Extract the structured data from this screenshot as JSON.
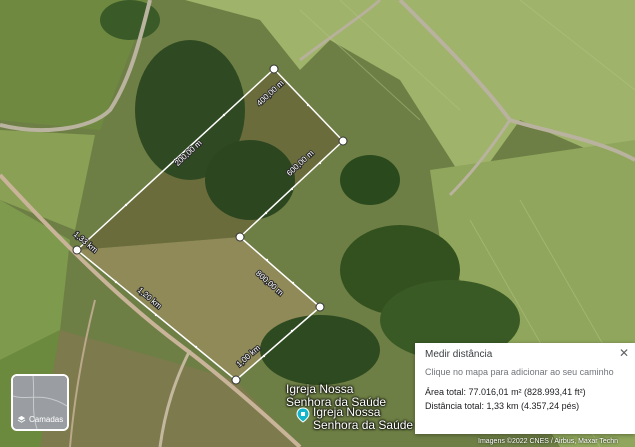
{
  "map": {
    "segment_labels": [
      "400,00 m",
      "600,00 m",
      "200,00 m",
      "800,00 m",
      "1,00 km",
      "1,20 km",
      "1,33 km"
    ],
    "place_name": "Igreja Nossa Senhora da Saúde",
    "place_name_line1": "Igreja Nossa",
    "place_name_line2": "Senhora da Saúde",
    "poi_icon": "church-place-pin-icon",
    "attribution": "Imagens ©2022 CNES / Airbus, Maxar Techn"
  },
  "layers_button": {
    "label": "Camadas",
    "icon": "layers-icon"
  },
  "measure_panel": {
    "title": "Medir distância",
    "hint": "Clique no mapa para adicionar ao seu caminho",
    "area": "Área total: 77.016,01 m² (828.993,41 ft²)",
    "distance": "Distância total: 1,33 km (4.357,24 pés)",
    "close_icon": "close-icon"
  },
  "colors": {
    "measure_line": "#ffffff",
    "panel_bg": "#ffffff",
    "poi_teal": "#12b5cb"
  }
}
